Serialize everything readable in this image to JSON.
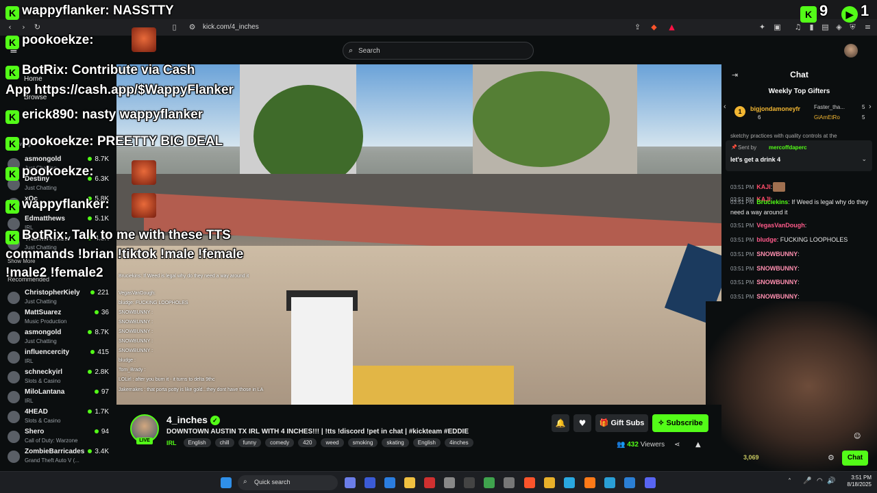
{
  "browser": {
    "url": "kick.com/4_inches"
  },
  "search": {
    "placeholder": "Search"
  },
  "sidebar": {
    "home": "Home",
    "browse": "Browse",
    "following_label": "Following",
    "show_more": "Show More",
    "recommended_label": "Recommended",
    "following": [
      {
        "name": "asmongold",
        "category": "Just Chatting",
        "viewers": "8.7K"
      },
      {
        "name": "Destiny",
        "category": "Just Chatting",
        "viewers": "6.3K"
      },
      {
        "name": "xQc",
        "category": "",
        "viewers": "5.8K"
      },
      {
        "name": "Edmatthews",
        "category": "IRL",
        "viewers": "5.1K"
      },
      {
        "name": "Trainwreckstv",
        "category": "Just Chatting",
        "viewers": "4.8K"
      }
    ],
    "recommended": [
      {
        "name": "ChristopherKiely",
        "category": "Just Chatting",
        "viewers": "221"
      },
      {
        "name": "MattSuarez",
        "category": "Music Production",
        "viewers": "36"
      },
      {
        "name": "asmongold",
        "category": "Just Chatting",
        "viewers": "8.7K"
      },
      {
        "name": "influencercity",
        "category": "IRL",
        "viewers": "415"
      },
      {
        "name": "schneckyirl",
        "category": "Slots & Casino",
        "viewers": "2.8K"
      },
      {
        "name": "MiloLantana",
        "category": "IRL",
        "viewers": "97"
      },
      {
        "name": "4HEAD",
        "category": "Slots & Casino",
        "viewers": "1.7K"
      },
      {
        "name": "Shero",
        "category": "Call of Duty: Warzone",
        "viewers": "94"
      },
      {
        "name": "ZombieBarricades",
        "category": "Grand Theft Auto V (...",
        "viewers": "3.4K"
      }
    ]
  },
  "overlay": {
    "counter_left": "9",
    "counter_right": "1",
    "messages": [
      {
        "user": "wappyflanker:",
        "text": "NASSTTY"
      },
      {
        "user": "pookoekze:",
        "text": ""
      },
      {
        "user": "BotRix:",
        "text": "Contribute via Cash"
      },
      {
        "user": "",
        "text": "App https://cash.app/$WappyFlanker"
      },
      {
        "user": "erick890:",
        "text": "nasty wappyflanker"
      },
      {
        "user": "pookoekze:",
        "text": "PREETTY BIG DEAL"
      },
      {
        "user": "pookoekze:",
        "text": ""
      },
      {
        "user": "wappyflanker:",
        "text": ""
      },
      {
        "user": "BotRix:",
        "text": "Talk to me with these TTS"
      },
      {
        "user": "",
        "text": "commands !brian !tiktok !male !female"
      },
      {
        "user": "",
        "text": "!male2 !female2"
      }
    ],
    "mini_chat": [
      "Bruciekins: If Weed is legal why do they need a way around it",
      "VegasVanDough:",
      "bludge: FUCKING LOOPHOLES",
      "SNOWBUNNY :",
      "SNOWBUNNY :",
      "SNOWBUNNY :",
      "SNOWBUNNY :",
      "SNOWBUNNY :",
      "bludge :",
      "Tom_Brady :",
      "LOLirl : after you burn it - it turns to delta 9thc",
      "Jakemakes : that porta potty is like gold...they dont have those in LA"
    ]
  },
  "stream": {
    "streamer": "4_inches",
    "live_label": "LIVE",
    "title": "DOWNTOWN AUSTIN TX IRL WITH 4 INCHES!!! | !tts !discord !pet in chat | #kickteam #EDDIE",
    "category": "IRL",
    "tags": [
      "English",
      "chill",
      "funny",
      "comedy",
      "420",
      "weed",
      "smoking",
      "skating",
      "English",
      "4inches"
    ],
    "viewers": "432",
    "viewers_label": "Viewers",
    "gift_label": "Gift Subs",
    "subscribe_label": "Subscribe"
  },
  "chat": {
    "title": "Chat",
    "weekly_gifters_label": "Weekly Top Gifters",
    "gifters": [
      {
        "rank": "1",
        "name": "bigjondamoneyfr",
        "count": "6"
      },
      {
        "name": "Faster_tha...",
        "count": "5"
      },
      {
        "name": "GiAmEtRo",
        "count": "5"
      }
    ],
    "pinned": {
      "label": "Sent by",
      "user": "mercoffdaperc",
      "text": "let's get a drink 4"
    },
    "partial_line": "sketchy practices with quality controls at the",
    "messages": [
      {
        "time": "03:51 PM",
        "user": "KAJI",
        "text": ":",
        "color": "#ff4d6a"
      },
      {
        "time": "03:51 PM",
        "user": "KAJI",
        "text": ":",
        "color": "#ff4d6a"
      },
      {
        "time": "03:51 PM",
        "user": "Bruciekins",
        "text": ": If Weed is legal why do they need a way around it",
        "color": "#53fc18"
      },
      {
        "time": "03:51 PM",
        "user": "VegasVanDough",
        "text": ":",
        "color": "#ff5a8a"
      },
      {
        "time": "03:51 PM",
        "user": "bludge",
        "text": ": FUCKING LOOPHOLES",
        "color": "#ff5a8a"
      },
      {
        "time": "03:51 PM",
        "user": "SNOWBUNNY",
        "text": ":",
        "color": "#ff8fb0"
      },
      {
        "time": "03:51 PM",
        "user": "SNOWBUNNY",
        "text": ":",
        "color": "#ff8fb0"
      },
      {
        "time": "03:51 PM",
        "user": "SNOWBUNNY",
        "text": ":",
        "color": "#ff8fb0"
      },
      {
        "time": "03:51 PM",
        "user": "SNOWBUNNY",
        "text": ":",
        "color": "#ff8fb0"
      }
    ],
    "webcam_counter": "3,069",
    "chat_button": "Chat"
  },
  "taskbar": {
    "search_label": "Quick search",
    "time": "3:51 PM",
    "date": "8/18/2025"
  },
  "colors": {
    "accent": "#53fc18",
    "bg": "#0b0e0f"
  }
}
